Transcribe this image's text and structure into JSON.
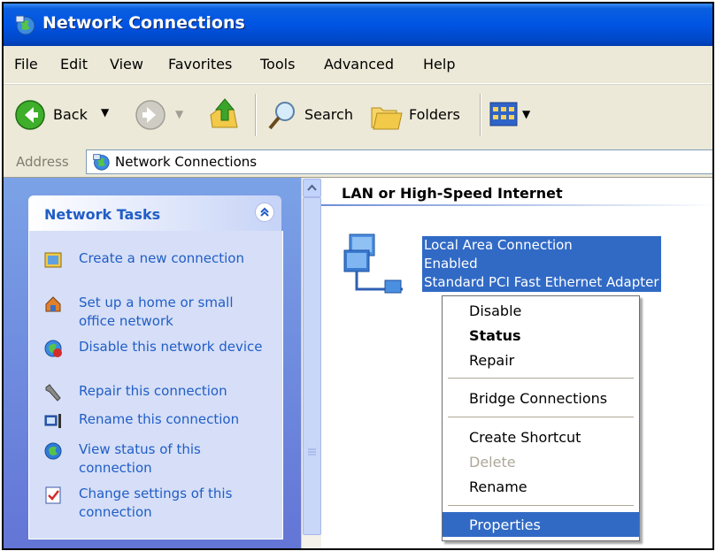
{
  "window": {
    "title": "Network Connections"
  },
  "menu": [
    "File",
    "Edit",
    "View",
    "Favorites",
    "Tools",
    "Advanced",
    "Help"
  ],
  "toolbar": {
    "back_label": "Back",
    "search_label": "Search",
    "folders_label": "Folders"
  },
  "address": {
    "label": "Address",
    "value": "Network Connections"
  },
  "tasks": {
    "header": "Network Tasks",
    "items": [
      {
        "label": "Create a new connection",
        "icon": "new-connection-icon"
      },
      {
        "label": "Set up a home or small office network",
        "icon": "home-network-icon"
      },
      {
        "label": "Disable this network device",
        "icon": "disable-network-icon"
      },
      {
        "label": "Repair this connection",
        "icon": "repair-icon"
      },
      {
        "label": "Rename this connection",
        "icon": "rename-icon"
      },
      {
        "label": "View status of this connection",
        "icon": "status-icon"
      },
      {
        "label": "Change settings of this connection",
        "icon": "settings-icon"
      }
    ]
  },
  "group": {
    "title": "LAN or High-Speed Internet"
  },
  "connection": {
    "name": "Local Area Connection",
    "status": "Enabled",
    "device": "Standard PCI Fast Ethernet Adapter"
  },
  "context_menu": {
    "disable": "Disable",
    "status": "Status",
    "repair": "Repair",
    "bridge": "Bridge Connections",
    "shortcut": "Create Shortcut",
    "delete": "Delete",
    "rename": "Rename",
    "properties": "Properties"
  },
  "colors": {
    "title_bar": "#0054e3",
    "selection": "#316ac5",
    "task_link": "#215dc6",
    "task_pane": "#6375d6"
  }
}
